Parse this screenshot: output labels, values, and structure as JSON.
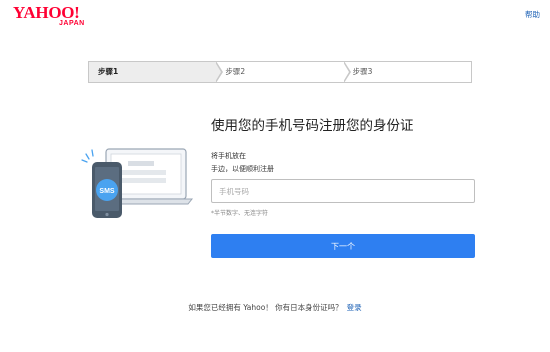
{
  "header": {
    "logo_main": "YAHOO!",
    "logo_sub": "JAPAN",
    "help_label": "帮助"
  },
  "stepper": {
    "steps": [
      {
        "label": "步骤1",
        "active": true
      },
      {
        "label": "步骤2",
        "active": false
      },
      {
        "label": "步骤3",
        "active": false
      }
    ]
  },
  "main": {
    "title": "使用您的手机号码注册您的身份证",
    "instruction_line1": "将手机放在",
    "instruction_line2": "手边，以便顺利注册",
    "phone_placeholder": "手机号码",
    "phone_value": "",
    "hint": "*半节数字、无连字符",
    "next_label": "下一个"
  },
  "illustration": {
    "sms_label": "SMS"
  },
  "footer": {
    "question": "如果您已经拥有 Yahoo！ 你有日本身份证吗？",
    "login_label": "登录"
  },
  "colors": {
    "brand_red": "#ff0033",
    "primary_blue": "#2e7ff1",
    "link_blue": "#1a5fb4",
    "phone_body": "#4a5a6a",
    "sms_bubble": "#4aa3f0"
  }
}
